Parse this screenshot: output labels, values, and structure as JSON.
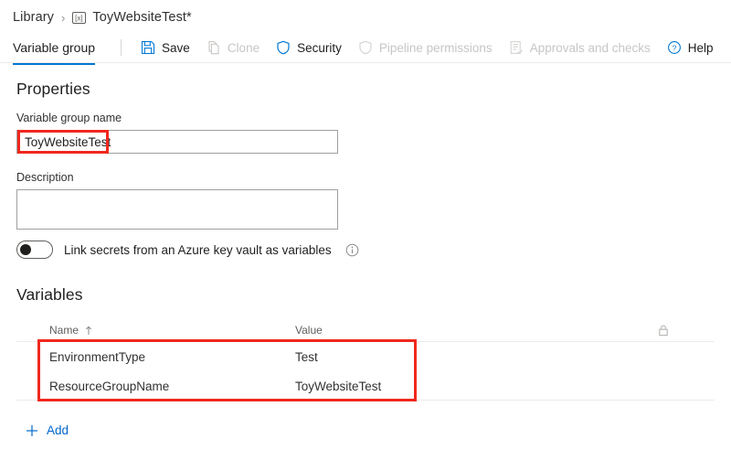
{
  "breadcrumb": {
    "root_label": "Library",
    "separator": "›",
    "icon_name": "variable-group-icon",
    "current_label": "ToyWebsiteTest*"
  },
  "toolbar": {
    "tab_label": "Variable group",
    "buttons": [
      {
        "label": "Save",
        "icon": "save-icon",
        "enabled": true
      },
      {
        "label": "Clone",
        "icon": "clone-icon",
        "enabled": false
      },
      {
        "label": "Security",
        "icon": "shield-icon",
        "enabled": true
      },
      {
        "label": "Pipeline permissions",
        "icon": "shield-outline-icon",
        "enabled": false
      },
      {
        "label": "Approvals and checks",
        "icon": "checklist-icon",
        "enabled": false
      },
      {
        "label": "Help",
        "icon": "help-circle-icon",
        "enabled": true
      }
    ]
  },
  "properties": {
    "title": "Properties",
    "name_label": "Variable group name",
    "name_value": "ToyWebsiteTest",
    "name_placeholder": "",
    "description_label": "Description",
    "description_value": "",
    "description_placeholder": "",
    "toggle_label": "Link secrets from an Azure key vault as variables",
    "toggle_state": "off",
    "info_icon": "info-circle-icon"
  },
  "variables": {
    "title": "Variables",
    "columns": {
      "name": "Name",
      "sort_indicator": "↑",
      "value": "Value",
      "lock_icon": "lock-icon"
    },
    "rows": [
      {
        "name": "EnvironmentType",
        "value": "Test"
      },
      {
        "name": "ResourceGroupName",
        "value": "ToyWebsiteTest"
      }
    ],
    "add_label": "Add",
    "add_icon": "plus-icon"
  },
  "annotations": {
    "accent_color": "#f0281e",
    "boxes": [
      "variable-group-name-value",
      "variables-rows"
    ]
  },
  "colors": {
    "accent": "#0078d4",
    "link": "#0066cc",
    "text": "#201f1e",
    "muted": "#605e5c",
    "disabled": "#c8c6c4",
    "divider": "#edebe9",
    "annotation": "#f0281e"
  }
}
